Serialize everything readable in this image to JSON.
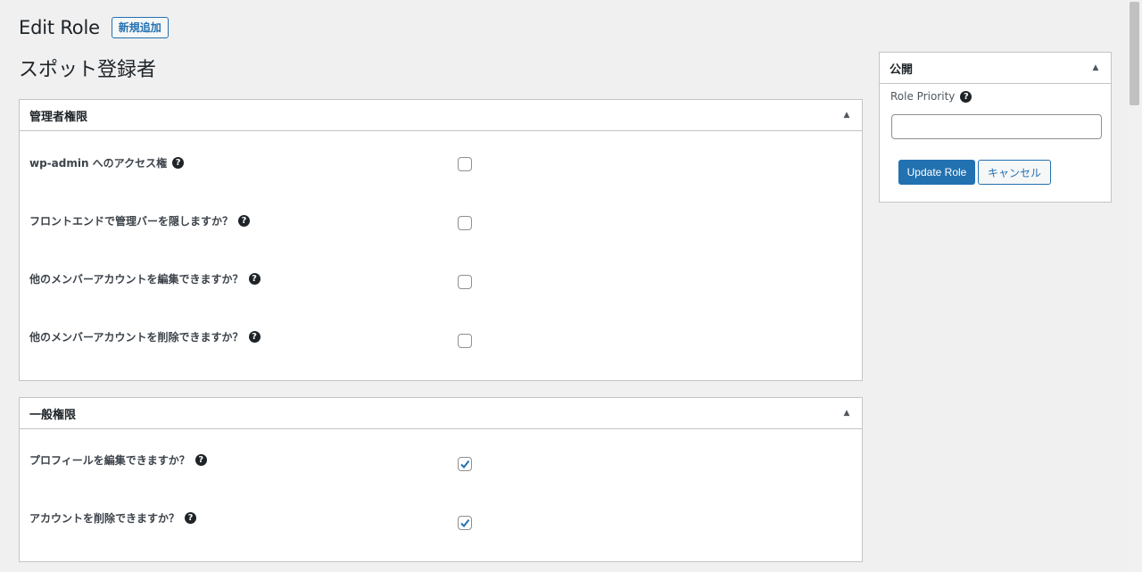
{
  "header": {
    "title": "Edit Role",
    "add_new_label": "新規追加"
  },
  "role_name": "スポット登録者",
  "admin_section": {
    "title": "管理者権限",
    "items": [
      {
        "label": "wp-admin へのアクセス権",
        "checked": false
      },
      {
        "label": "フロントエンドで管理バーを隠しますか？",
        "checked": false
      },
      {
        "label": "他のメンバーアカウントを編集できますか？",
        "checked": false
      },
      {
        "label": "他のメンバーアカウントを削除できますか？",
        "checked": false
      }
    ]
  },
  "general_section": {
    "title": "一般権限",
    "items": [
      {
        "label": "プロフィールを編集できますか？",
        "checked": true
      },
      {
        "label": "アカウントを削除できますか？",
        "checked": true
      }
    ]
  },
  "publish_box": {
    "title": "公開",
    "priority_label": "Role Priority",
    "priority_value": "",
    "update_label": "Update Role",
    "cancel_label": "キャンセル"
  },
  "icons": {
    "help": "?",
    "collapse": "▲"
  },
  "colors": {
    "primary": "#2271b1",
    "checkmark": "#2271b1"
  }
}
